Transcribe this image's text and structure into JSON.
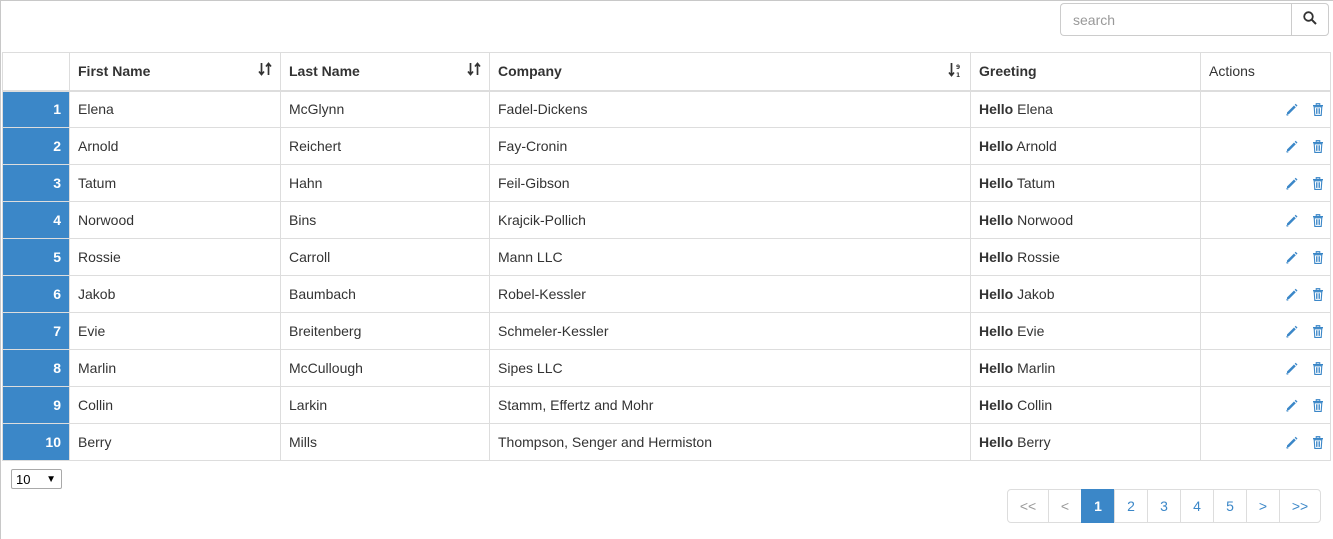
{
  "search": {
    "placeholder": "search"
  },
  "table": {
    "headers": {
      "first_name": "First Name",
      "last_name": "Last Name",
      "company": "Company",
      "greeting": "Greeting",
      "actions": "Actions"
    },
    "greeting_prefix": "Hello",
    "rows": [
      {
        "num": "1",
        "first": "Elena",
        "last": "McGlynn",
        "company": "Fadel-Dickens"
      },
      {
        "num": "2",
        "first": "Arnold",
        "last": "Reichert",
        "company": "Fay-Cronin"
      },
      {
        "num": "3",
        "first": "Tatum",
        "last": "Hahn",
        "company": "Feil-Gibson"
      },
      {
        "num": "4",
        "first": "Norwood",
        "last": "Bins",
        "company": "Krajcik-Pollich"
      },
      {
        "num": "5",
        "first": "Rossie",
        "last": "Carroll",
        "company": "Mann LLC"
      },
      {
        "num": "6",
        "first": "Jakob",
        "last": "Baumbach",
        "company": "Robel-Kessler"
      },
      {
        "num": "7",
        "first": "Evie",
        "last": "Breitenberg",
        "company": "Schmeler-Kessler"
      },
      {
        "num": "8",
        "first": "Marlin",
        "last": "McCullough",
        "company": "Sipes LLC"
      },
      {
        "num": "9",
        "first": "Collin",
        "last": "Larkin",
        "company": "Stamm, Effertz and Mohr"
      },
      {
        "num": "10",
        "first": "Berry",
        "last": "Mills",
        "company": "Thompson, Senger and Hermiston"
      }
    ]
  },
  "page_size": {
    "value": "10"
  },
  "pagination": {
    "first": "<<",
    "prev": "<",
    "pages": [
      "1",
      "2",
      "3",
      "4",
      "5"
    ],
    "active_page": "1",
    "next": ">",
    "last": ">>"
  },
  "colors": {
    "accent": "#3b87c8",
    "border": "#dddddd"
  }
}
